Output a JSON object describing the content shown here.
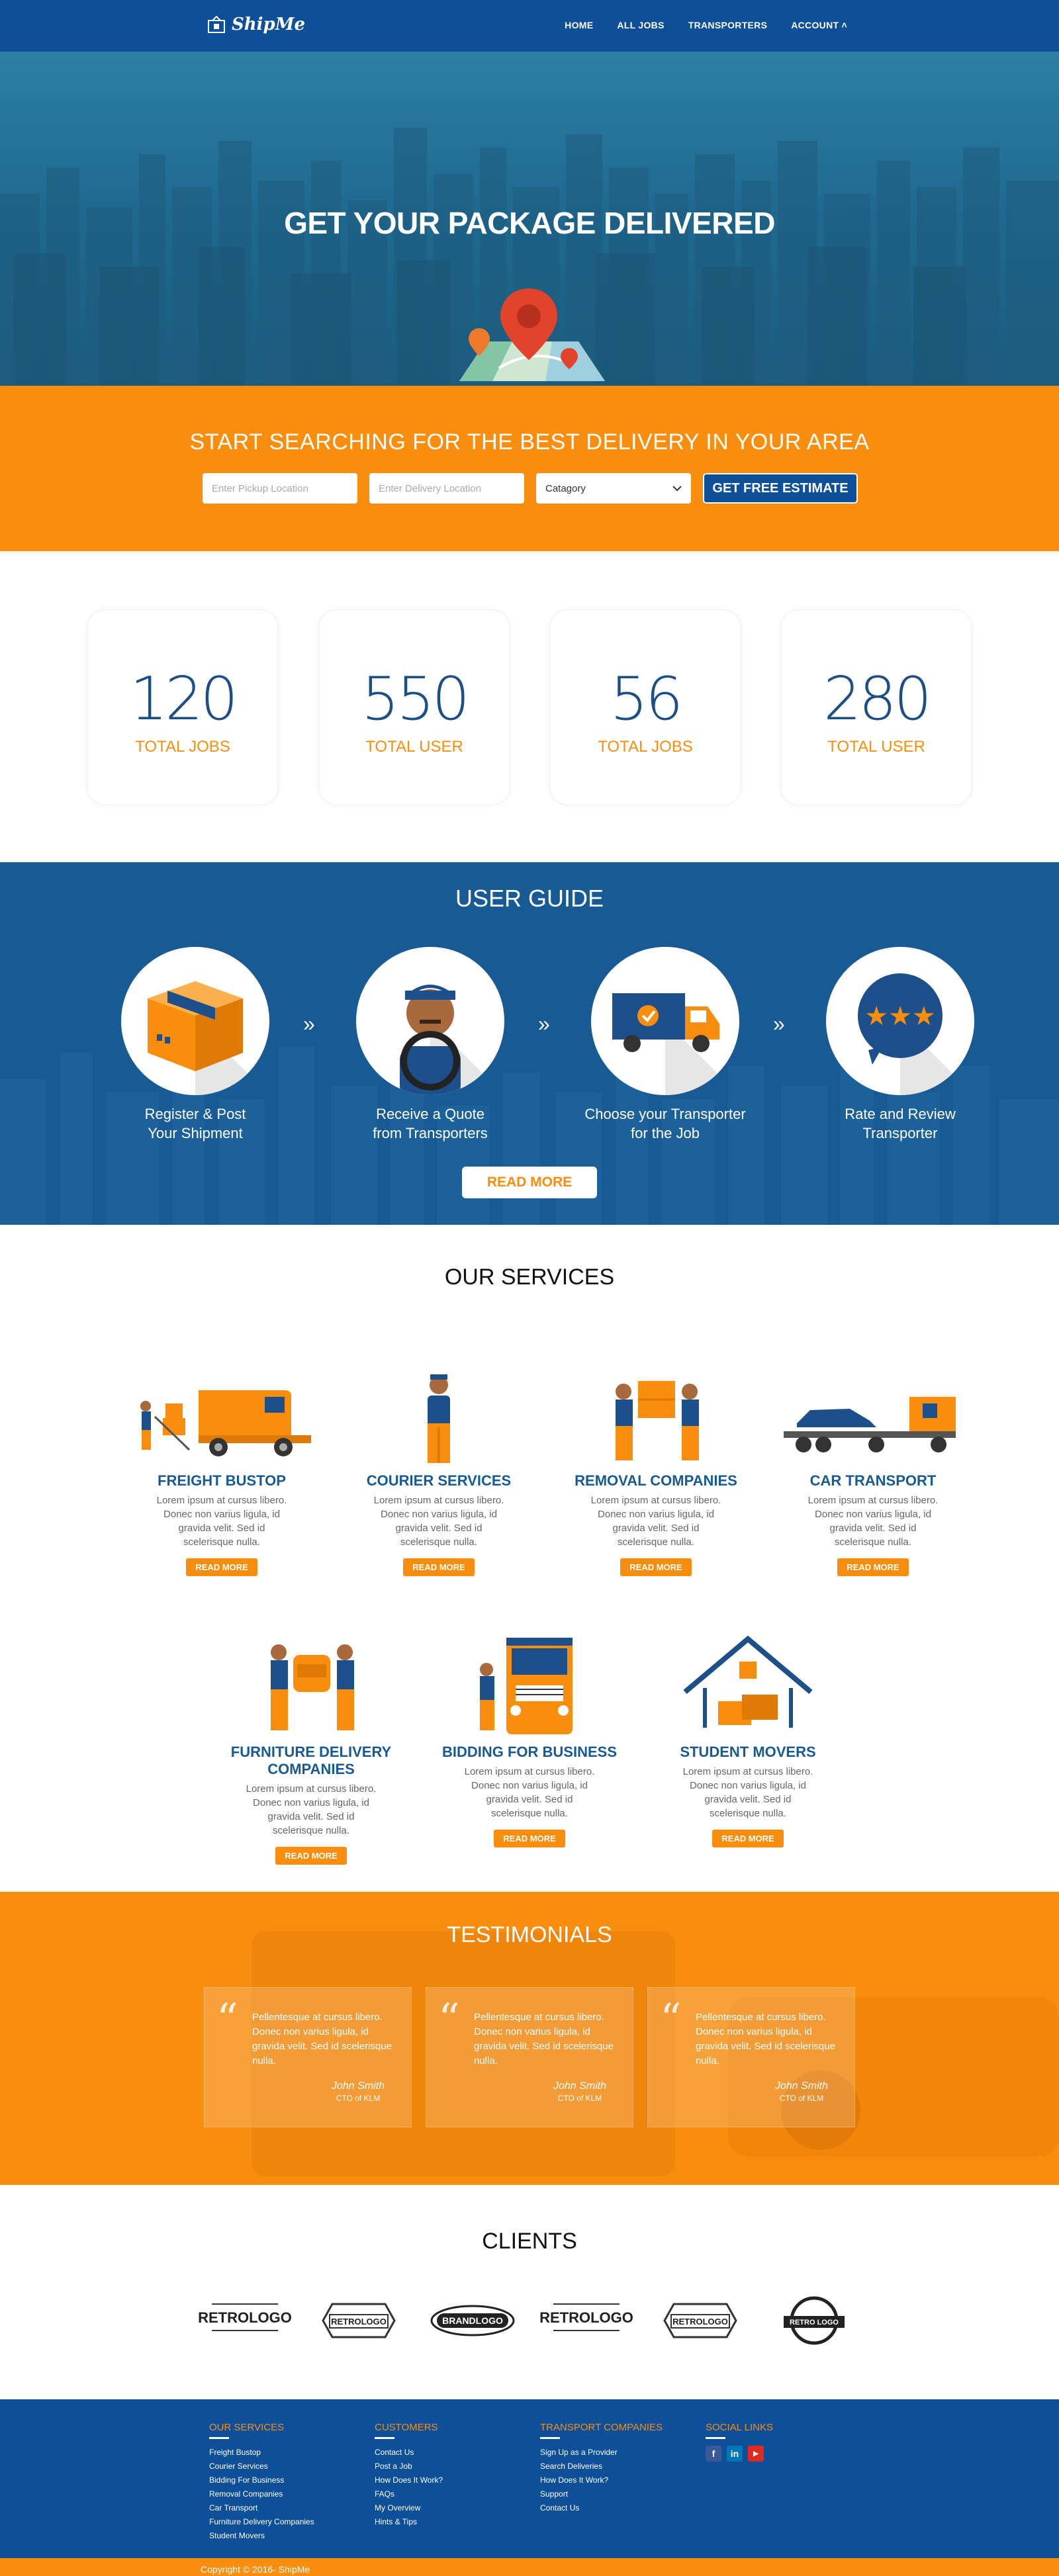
{
  "brand": {
    "name": "ShipMe",
    "logo_icon": "shipme-logo-icon"
  },
  "nav": {
    "items": [
      "HOME",
      "ALL JOBS",
      "TRANSPORTERS",
      "ACCOUNT ˄"
    ]
  },
  "hero": {
    "title": "GET YOUR PACKAGE DELIVERED",
    "icon": "map-pin-icon"
  },
  "search": {
    "title": "START SEARCHING FOR THE BEST DELIVERY IN YOUR AREA",
    "pickup_placeholder": "Enter Pickup Location",
    "delivery_placeholder": "Enter Delivery Location",
    "category_value": "Catagory",
    "button": "GET FREE ESTIMATE"
  },
  "stats": [
    {
      "number": "120",
      "label": "TOTAL JOBS"
    },
    {
      "number": "550",
      "label": "TOTAL USER"
    },
    {
      "number": "56",
      "label": "TOTAL JOBS"
    },
    {
      "number": "280",
      "label": "TOTAL USER"
    }
  ],
  "guide": {
    "title": "USER GUIDE",
    "steps": [
      {
        "line1": "Register & Post",
        "line2": "Your Shipment",
        "icon": "package-box-icon"
      },
      {
        "line1": "Receive a Quote",
        "line2": "from Transporters",
        "icon": "driver-icon"
      },
      {
        "line1": "Choose your Transporter",
        "line2": "for the Job",
        "icon": "delivery-truck-icon"
      },
      {
        "line1": "Rate and Review",
        "line2": "Transporter",
        "icon": "rating-stars-icon"
      }
    ],
    "arrow": "»",
    "button": "READ MORE"
  },
  "services": {
    "title": "OUR SERVICES",
    "desc": "Lorem ipsum at cursus libero. Donec non varius ligula, id gravida velit. Sed id scelerisque nulla.",
    "button": "READ MORE",
    "items": [
      {
        "name": "FREIGHT BUSTOP",
        "icon": "freight-truck-icon"
      },
      {
        "name": "COURIER SERVICES",
        "icon": "courier-person-icon"
      },
      {
        "name": "REMOVAL COMPANIES",
        "icon": "movers-box-icon"
      },
      {
        "name": "CAR TRANSPORT",
        "icon": "car-carrier-icon"
      },
      {
        "name": "FURNITURE DELIVERY COMPANIES",
        "icon": "furniture-movers-icon"
      },
      {
        "name": "BIDDING FOR BUSINESS",
        "icon": "bidding-truck-icon"
      },
      {
        "name": "STUDENT MOVERS",
        "icon": "student-home-icon"
      }
    ]
  },
  "testimonials": {
    "title": "TESTIMONIALS",
    "quote_mark": "“",
    "items": [
      {
        "text": "Pellentesque at cursus libero. Donec non varius ligula, id gravida velit. Sed id scelerisque nulla.",
        "name": "John Smith",
        "role": "CTO of KLM"
      },
      {
        "text": "Pellentesque at cursus libero. Donec non varius ligula, id gravida velit. Sed id scelerisque nulla.",
        "name": "John Smith",
        "role": "CTO of KLM"
      },
      {
        "text": "Pellentesque at cursus libero. Donec non varius ligula, id gravida velit. Sed id scelerisque nulla.",
        "name": "John Smith",
        "role": "CTO of KLM"
      }
    ]
  },
  "clients": {
    "title": "CLIENTS",
    "logos": [
      "RETROLOGO",
      "RETROLOGO",
      "BRANDLOGO",
      "RETROLOGO",
      "RETROLOGO",
      "RETRO LOGO"
    ]
  },
  "footer": {
    "columns": [
      {
        "heading": "OUR SERVICES",
        "links": [
          "Freight Bustop",
          "Courier Services",
          "Bidding For Business",
          "Removal Companies",
          "Car Transport",
          "Furniture Delivery Companies",
          "Student Movers"
        ]
      },
      {
        "heading": "CUSTOMERS",
        "links": [
          "Contact Us",
          "Post a Job",
          "How Does It Work?",
          "FAQs",
          "My Overview",
          "Hints & Tips"
        ]
      },
      {
        "heading": "TRANSPORT COMPANIES",
        "links": [
          "Sign Up as a Provider",
          "Search Deliveries",
          "How Does It Work?",
          "Support",
          "Contact Us"
        ]
      },
      {
        "heading": "SOCIAL LINKS",
        "links": []
      }
    ],
    "social": [
      {
        "label": "f",
        "icon": "facebook-icon",
        "color": "#3b5998"
      },
      {
        "label": "in",
        "icon": "linkedin-icon",
        "color": "#0077b5"
      },
      {
        "label": "▶",
        "icon": "youtube-icon",
        "color": "#e02a20"
      }
    ],
    "copyright": "Copyright © 2016- ShipMe"
  },
  "colors": {
    "primary_blue": "#0e4f99",
    "guide_blue": "#175a94",
    "orange": "#f88d0e"
  }
}
